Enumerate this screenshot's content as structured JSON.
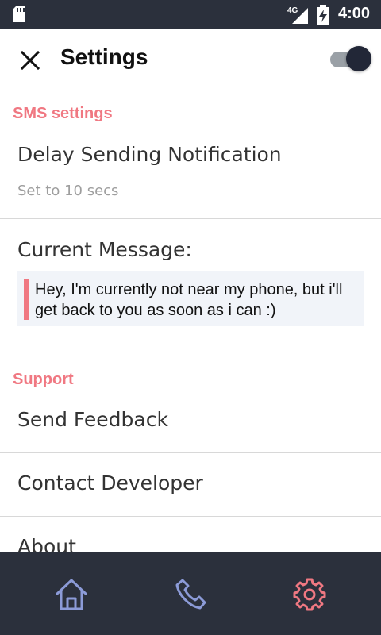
{
  "status_bar": {
    "network": "4G",
    "time": "4:00"
  },
  "app_bar": {
    "title": "Settings",
    "toggle_on": true
  },
  "sections": {
    "sms": {
      "header": "SMS settings",
      "delay_title": "Delay Sending Notification",
      "delay_value": "Set to 10 secs",
      "current_message_label": "Current Message:",
      "current_message": "Hey, I'm currently not near my phone, but i'll get back to you as soon as i can :)"
    },
    "support": {
      "header": "Support",
      "send_feedback": "Send Feedback",
      "contact_developer": "Contact Developer",
      "about": "About"
    }
  },
  "bottom_nav": {
    "items": [
      "home-icon",
      "phone-icon",
      "gear-icon"
    ],
    "active": "gear-icon"
  },
  "colors": {
    "accent": "#f07882",
    "nav_background": "#2b303c",
    "nav_inactive": "#8c9bd8",
    "message_background": "#f1f4f9"
  }
}
